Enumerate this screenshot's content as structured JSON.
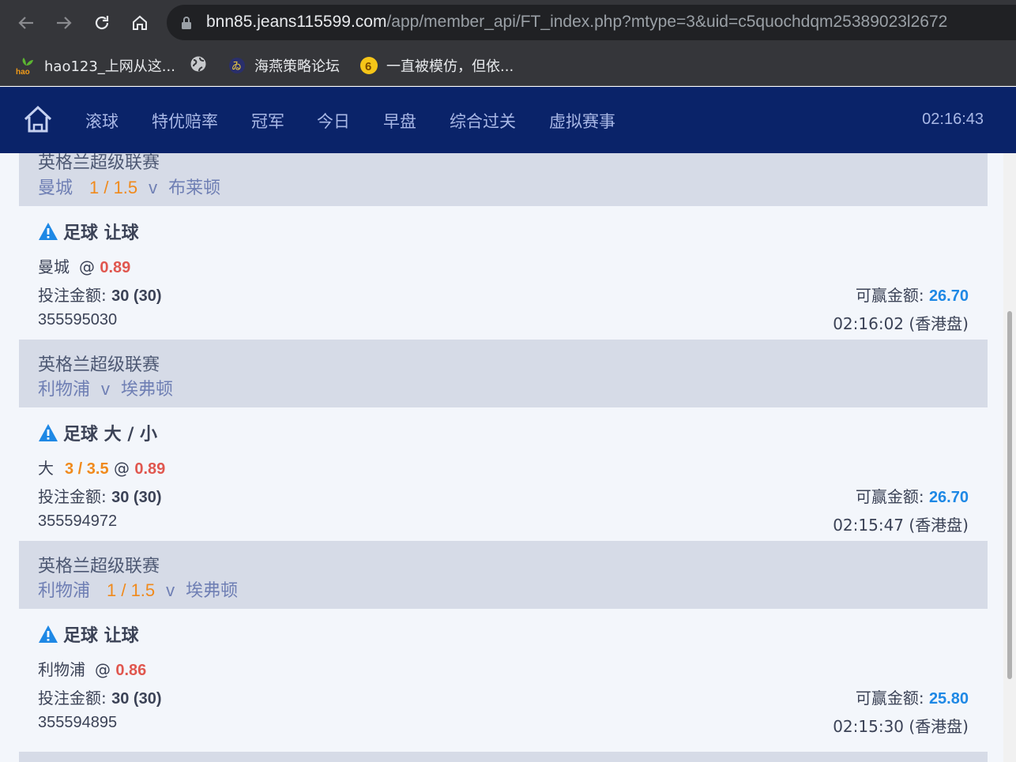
{
  "browser": {
    "url_host": "bnn85.jeans115599.com",
    "url_path": "/app/member_api/FT_index.php?mtype=3&uid=c5quochdqm25389023l2672",
    "bookmarks": [
      {
        "label": "hao123_上网从这...",
        "icon": "hao123-icon"
      },
      {
        "label": "",
        "icon": "globe-icon"
      },
      {
        "label": "海燕策略论坛",
        "icon": "site-icon"
      },
      {
        "label": "一直被模仿，但依...",
        "icon": "number6-icon"
      }
    ]
  },
  "header": {
    "menu": [
      "滚球",
      "特优赔率",
      "冠军",
      "今日",
      "早盘",
      "综合过关",
      "虚拟赛事"
    ],
    "clock": "02:16:43"
  },
  "labels": {
    "stake": "投注金额: ",
    "to_win": "可赢金额: ",
    "vs": "v",
    "at": "@"
  },
  "bets": [
    {
      "league": "英格兰超级联赛",
      "home": "曼城",
      "handicap": "1 / 1.5",
      "away": "布莱顿",
      "market": "足球 让球",
      "pick": "曼城",
      "line": "",
      "odds": "0.89",
      "stake": "30 (30)",
      "win": "26.70",
      "ticket": "355595030",
      "time": "02:16:02 (香港盘)"
    },
    {
      "league": "英格兰超级联赛",
      "home": "利物浦",
      "handicap": "",
      "away": "埃弗顿",
      "market": "足球 大 / 小",
      "pick": "大",
      "line": "3 / 3.5",
      "odds": "0.89",
      "stake": "30 (30)",
      "win": "26.70",
      "ticket": "355594972",
      "time": "02:15:47 (香港盘)"
    },
    {
      "league": "英格兰超级联赛",
      "home": "利物浦",
      "handicap": "1 / 1.5",
      "away": "埃弗顿",
      "market": "足球 让球",
      "pick": "利物浦",
      "line": "",
      "odds": "0.86",
      "stake": "30 (30)",
      "win": "25.80",
      "ticket": "355594895",
      "time": "02:15:30 (香港盘)"
    }
  ],
  "colors": {
    "header_bg": "#0a2369",
    "odds": "#e0574f",
    "handicap": "#f08a1c",
    "win_amount": "#1e88e5"
  }
}
